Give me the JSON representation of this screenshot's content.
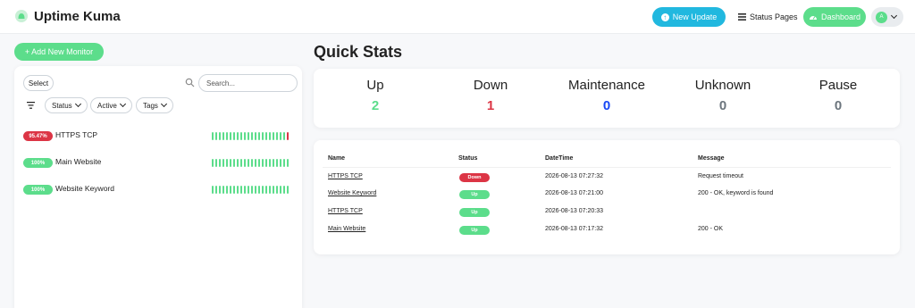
{
  "app": {
    "title": "Uptime Kuma"
  },
  "header": {
    "new_update": "New Update",
    "status_pages": "Status Pages",
    "dashboard": "Dashboard",
    "avatar_initial": "A"
  },
  "monitor_list": {
    "add_button": "+ Add New Monitor",
    "select_button": "Select",
    "search_placeholder": "Search...",
    "filters": [
      {
        "label": "Status"
      },
      {
        "label": "Active"
      },
      {
        "label": "Tags"
      }
    ],
    "monitors": [
      {
        "name": "HTTPS TCP",
        "uptime": "95.47%",
        "badge_color": "#dc3545",
        "last_beat_down": true
      },
      {
        "name": "Main Website",
        "uptime": "100%",
        "badge_color": "#5cdd8b",
        "last_beat_down": false
      },
      {
        "name": "Website Keyword",
        "uptime": "100%",
        "badge_color": "#5cdd8b",
        "last_beat_down": false
      }
    ]
  },
  "quick_stats": {
    "title": "Quick Stats",
    "items": [
      {
        "label": "Up",
        "value": "2",
        "color": "#5cdd8b"
      },
      {
        "label": "Down",
        "value": "1",
        "color": "#dc3545"
      },
      {
        "label": "Maintenance",
        "value": "0",
        "color": "#1747f5"
      },
      {
        "label": "Unknown",
        "value": "0",
        "color": "#6c757d"
      },
      {
        "label": "Pause",
        "value": "0",
        "color": "#6c757d"
      }
    ]
  },
  "events": {
    "headers": {
      "name": "Name",
      "status": "Status",
      "datetime": "DateTime",
      "message": "Message"
    },
    "rows": [
      {
        "name": "HTTPS TCP",
        "status": "Down",
        "status_color": "#dc3545",
        "datetime": "2026-08-13 07:27:32",
        "message": "Request timeout"
      },
      {
        "name": "Website Keyword",
        "status": "Up",
        "status_color": "#5cdd8b",
        "datetime": "2026-08-13 07:21:00",
        "message": "200 - OK, keyword is found"
      },
      {
        "name": "HTTPS TCP",
        "status": "Up",
        "status_color": "#5cdd8b",
        "datetime": "2026-08-13 07:20:33",
        "message": ""
      },
      {
        "name": "Main Website",
        "status": "Up",
        "status_color": "#5cdd8b",
        "datetime": "2026-08-13 07:17:32",
        "message": "200 - OK"
      }
    ]
  }
}
